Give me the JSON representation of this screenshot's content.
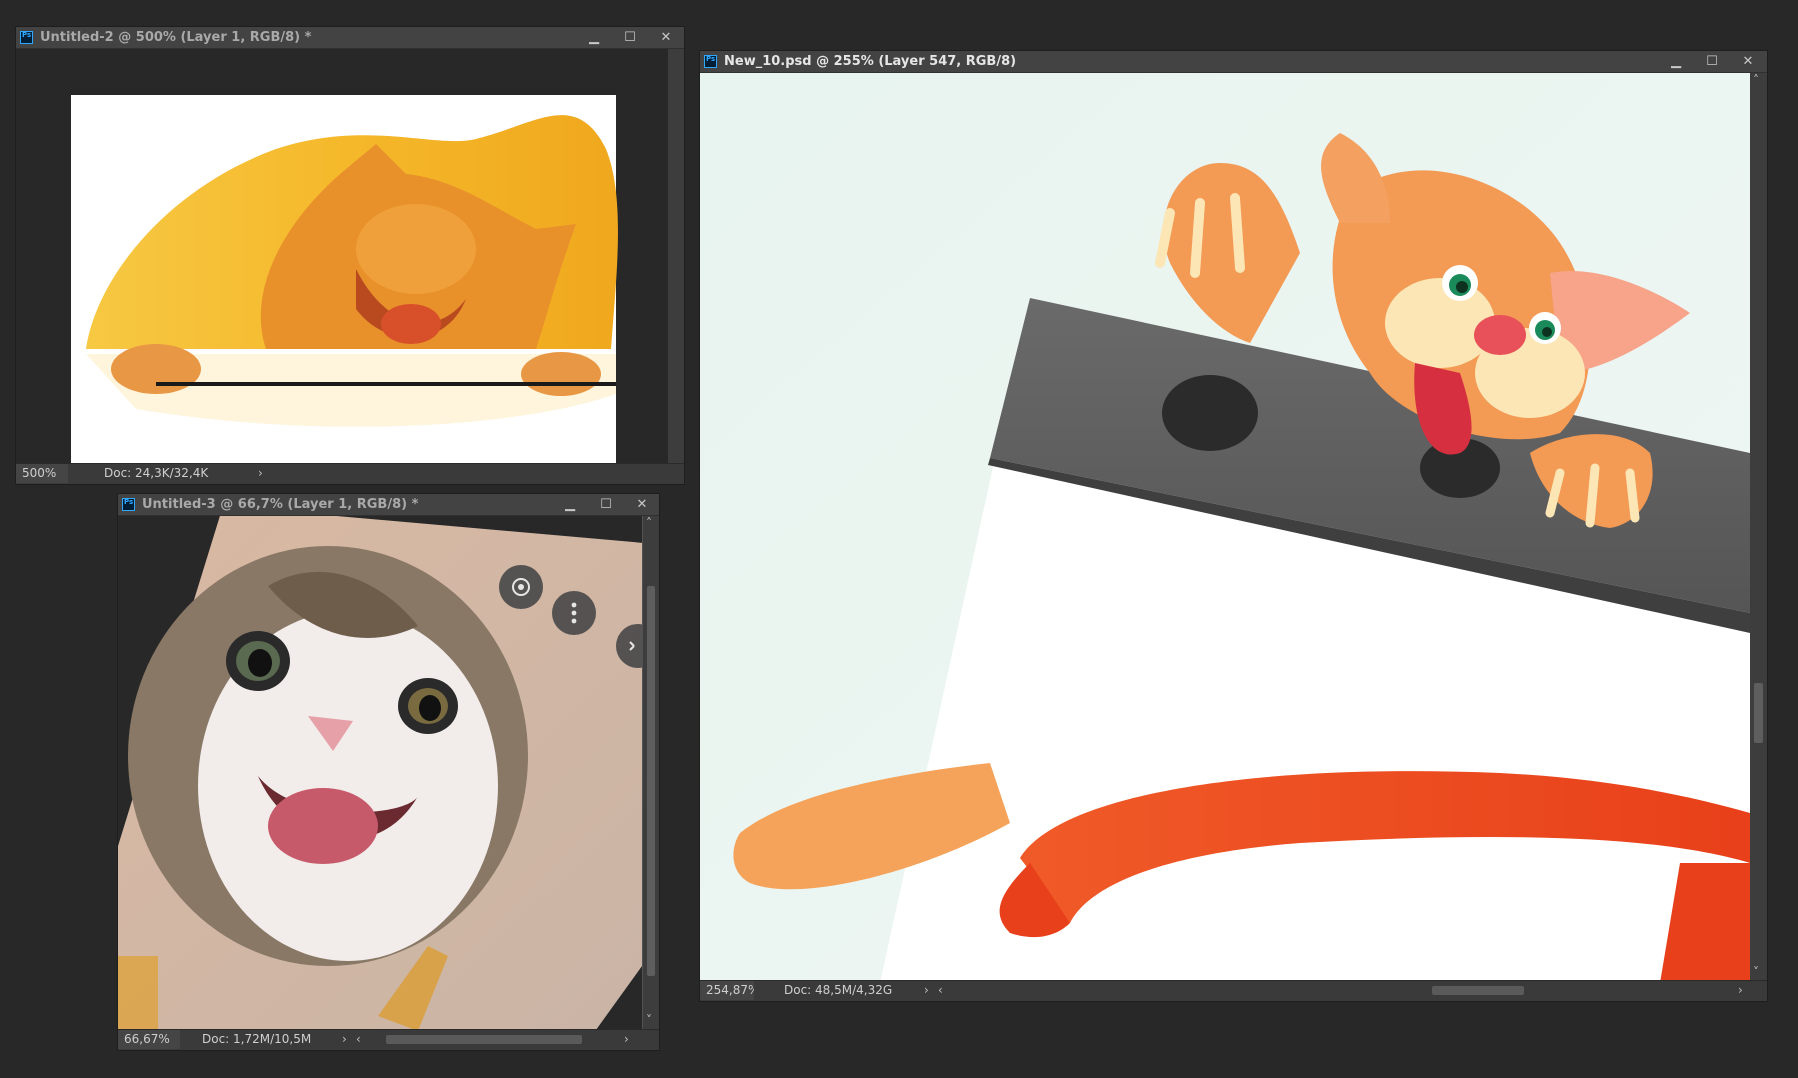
{
  "windows": {
    "untitled2": {
      "title": "Untitled-2 @ 500% (Layer 1, RGB/8) *",
      "zoom": "500%",
      "doc": "Doc: 24,3K/32,4K"
    },
    "untitled3": {
      "title": "Untitled-3 @ 66,7% (Layer 1, RGB/8) *",
      "zoom": "66,67%",
      "doc": "Doc: 1,72M/10,5M"
    },
    "new10": {
      "title": "New_10.psd @ 255% (Layer 547, RGB/8)",
      "zoom": "254,87%",
      "doc": "Doc: 48,5M/4,32G"
    }
  },
  "controls": {
    "minimize": "▁",
    "maximize": "☐",
    "close": "✕",
    "arrow_right": "›",
    "arrow_left": "‹",
    "arrow_up": "˄",
    "arrow_down": "˅"
  },
  "icons": {
    "app": "photoshop-icon",
    "lens": "lens-icon",
    "more": "more-vertical-icon",
    "chevron": "chevron-left-icon"
  },
  "colors": {
    "workspace": "#282828",
    "titlebar": "#434343",
    "statusbar": "#3a3a3a",
    "accent_ps": "#31a8ff"
  }
}
